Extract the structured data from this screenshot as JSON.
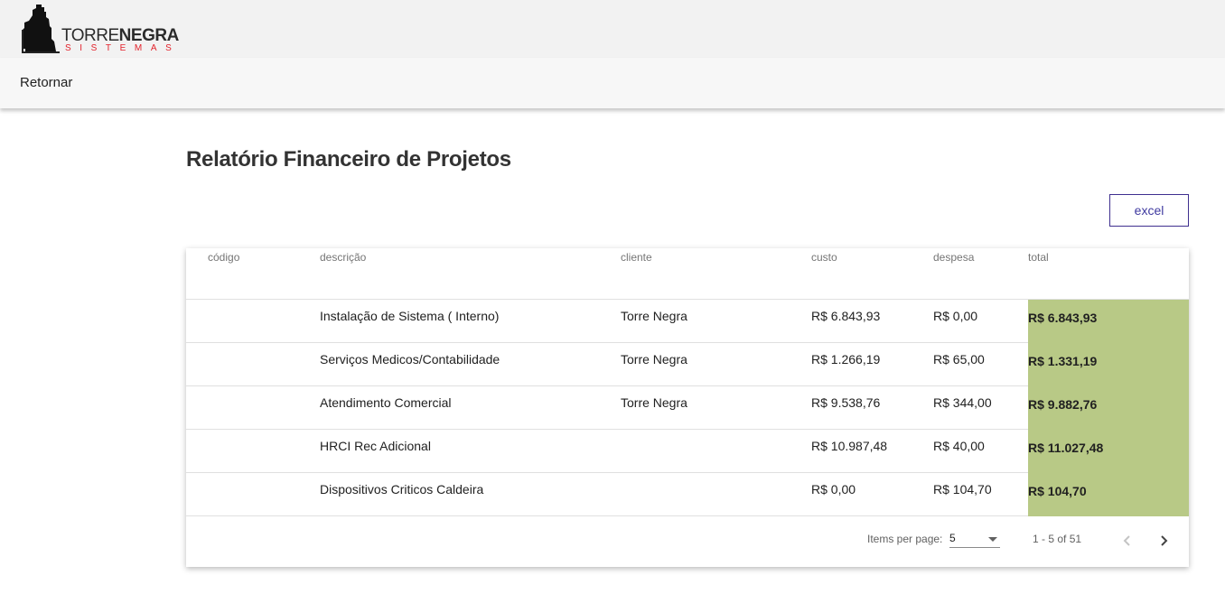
{
  "brand": {
    "word_thin": "TORRE",
    "word_bold": "NEGRA",
    "subtitle": "SISTEMAS",
    "accent_color": "#e3222b"
  },
  "nav": {
    "back_label": "Retornar"
  },
  "page": {
    "title": "Relatório Financeiro de Projetos"
  },
  "actions": {
    "excel_label": "excel"
  },
  "table": {
    "columns": {
      "code": "código",
      "description": "descrição",
      "client": "cliente",
      "cost": "custo",
      "expense": "despesa",
      "total": "total"
    },
    "rows": [
      {
        "code": "",
        "description": "Instalação de Sistema ( Interno)",
        "client": "Torre Negra",
        "cost": "R$ 6.843,93",
        "expense": "R$ 0,00",
        "total": "R$ 6.843,93"
      },
      {
        "code": "",
        "description": "Serviços Medicos/Contabilidade",
        "client": "Torre Negra",
        "cost": "R$ 1.266,19",
        "expense": "R$ 65,00",
        "total": "R$ 1.331,19"
      },
      {
        "code": "",
        "description": "Atendimento Comercial",
        "client": "Torre Negra",
        "cost": "R$ 9.538,76",
        "expense": "R$ 344,00",
        "total": "R$ 9.882,76"
      },
      {
        "code": "",
        "description": "HRCI Rec Adicional",
        "client": "",
        "cost": "R$ 10.987,48",
        "expense": "R$ 40,00",
        "total": "R$ 11.027,48"
      },
      {
        "code": "",
        "description": "Dispositivos Criticos Caldeira",
        "client": "",
        "cost": "R$ 0,00",
        "expense": "R$ 104,70",
        "total": "R$ 104,70"
      }
    ],
    "total_highlight_color": "#b8c986"
  },
  "paginator": {
    "items_per_page_label": "Items per page:",
    "page_size": "5",
    "range_label": "1 - 5 of 51",
    "prev_icon": "chevron-left-icon",
    "next_icon": "chevron-right-icon"
  }
}
